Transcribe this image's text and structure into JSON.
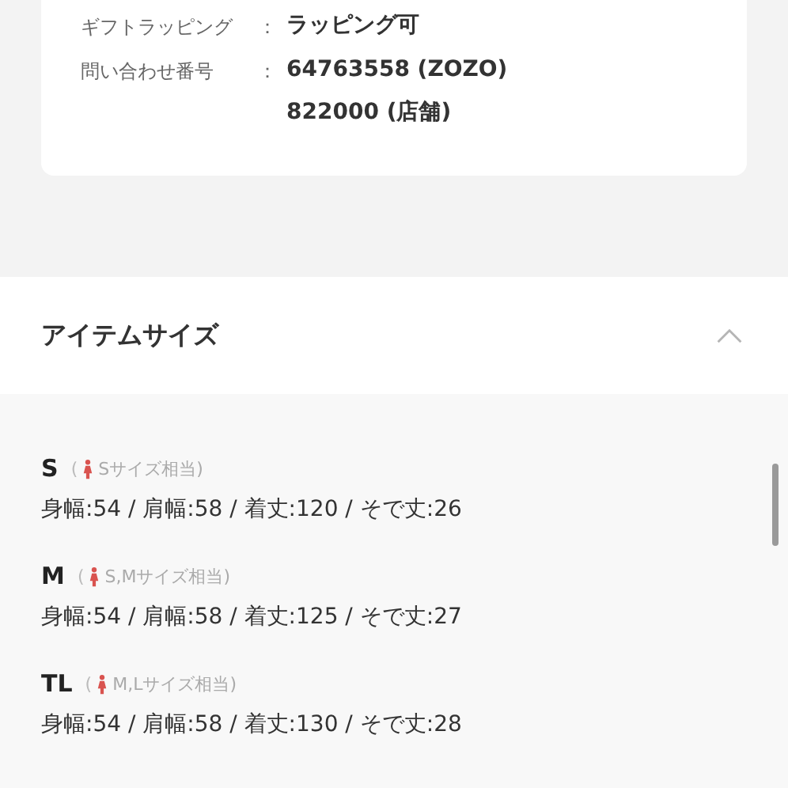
{
  "info_rows": [
    {
      "label": "ギフトラッピング",
      "separator": "：",
      "values": [
        "ラッピング可"
      ]
    },
    {
      "label": "問い合わせ番号",
      "separator": "：",
      "values": [
        "64763558 (ZOZO)",
        "822000 (店舗)"
      ]
    }
  ],
  "section": {
    "title": "アイテムサイズ",
    "expanded": true,
    "sizes": [
      {
        "name": "S",
        "open": "(",
        "equivalent": "Sサイズ相当)",
        "measurements": "身幅:54 / 肩幅:58 / 着丈:120 / そで丈:26"
      },
      {
        "name": "M",
        "open": "(",
        "equivalent": "S,Mサイズ相当)",
        "measurements": "身幅:54 / 肩幅:58 / 着丈:125 / そで丈:27"
      },
      {
        "name": "TL",
        "open": "(",
        "equivalent": "M,Lサイズ相当)",
        "measurements": "身幅:54 / 肩幅:58 / 着丈:130 / そで丈:28"
      }
    ]
  }
}
